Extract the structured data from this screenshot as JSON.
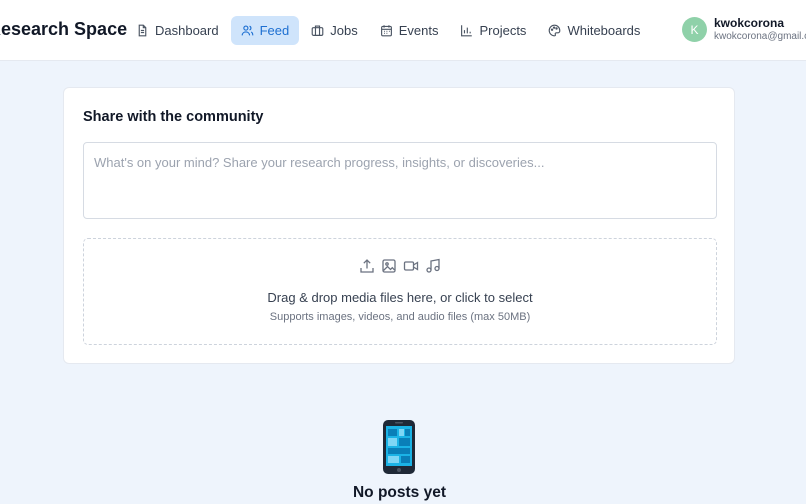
{
  "header": {
    "brand": "Research Space",
    "nav": [
      {
        "label": "Dashboard",
        "icon": "document-icon",
        "active": false
      },
      {
        "label": "Feed",
        "icon": "users-icon",
        "active": true
      },
      {
        "label": "Jobs",
        "icon": "briefcase-icon",
        "active": false
      },
      {
        "label": "Events",
        "icon": "calendar-icon",
        "active": false
      },
      {
        "label": "Projects",
        "icon": "bar-chart-icon",
        "active": false
      },
      {
        "label": "Whiteboards",
        "icon": "palette-icon",
        "active": false
      }
    ],
    "user": {
      "initial": "K",
      "name": "kwokcorona",
      "email": "kwokcorona@gmail.com"
    }
  },
  "composer": {
    "title": "Share with the community",
    "placeholder": "What's on your mind? Share your research progress, insights, or discoveries...",
    "dropzone": {
      "title": "Drag & drop media files here, or click to select",
      "subtitle": "Supports images, videos, and audio files (max 50MB)",
      "icons": [
        "upload-icon",
        "image-icon",
        "video-icon",
        "music-icon"
      ]
    }
  },
  "empty_state": {
    "icon": "mobile-phone-icon",
    "title": "No posts yet"
  },
  "colors": {
    "background": "#eef4fc",
    "active_nav_bg": "#cfe4fb",
    "active_nav_text": "#1d6fd1",
    "avatar": "#8fd1a9"
  }
}
